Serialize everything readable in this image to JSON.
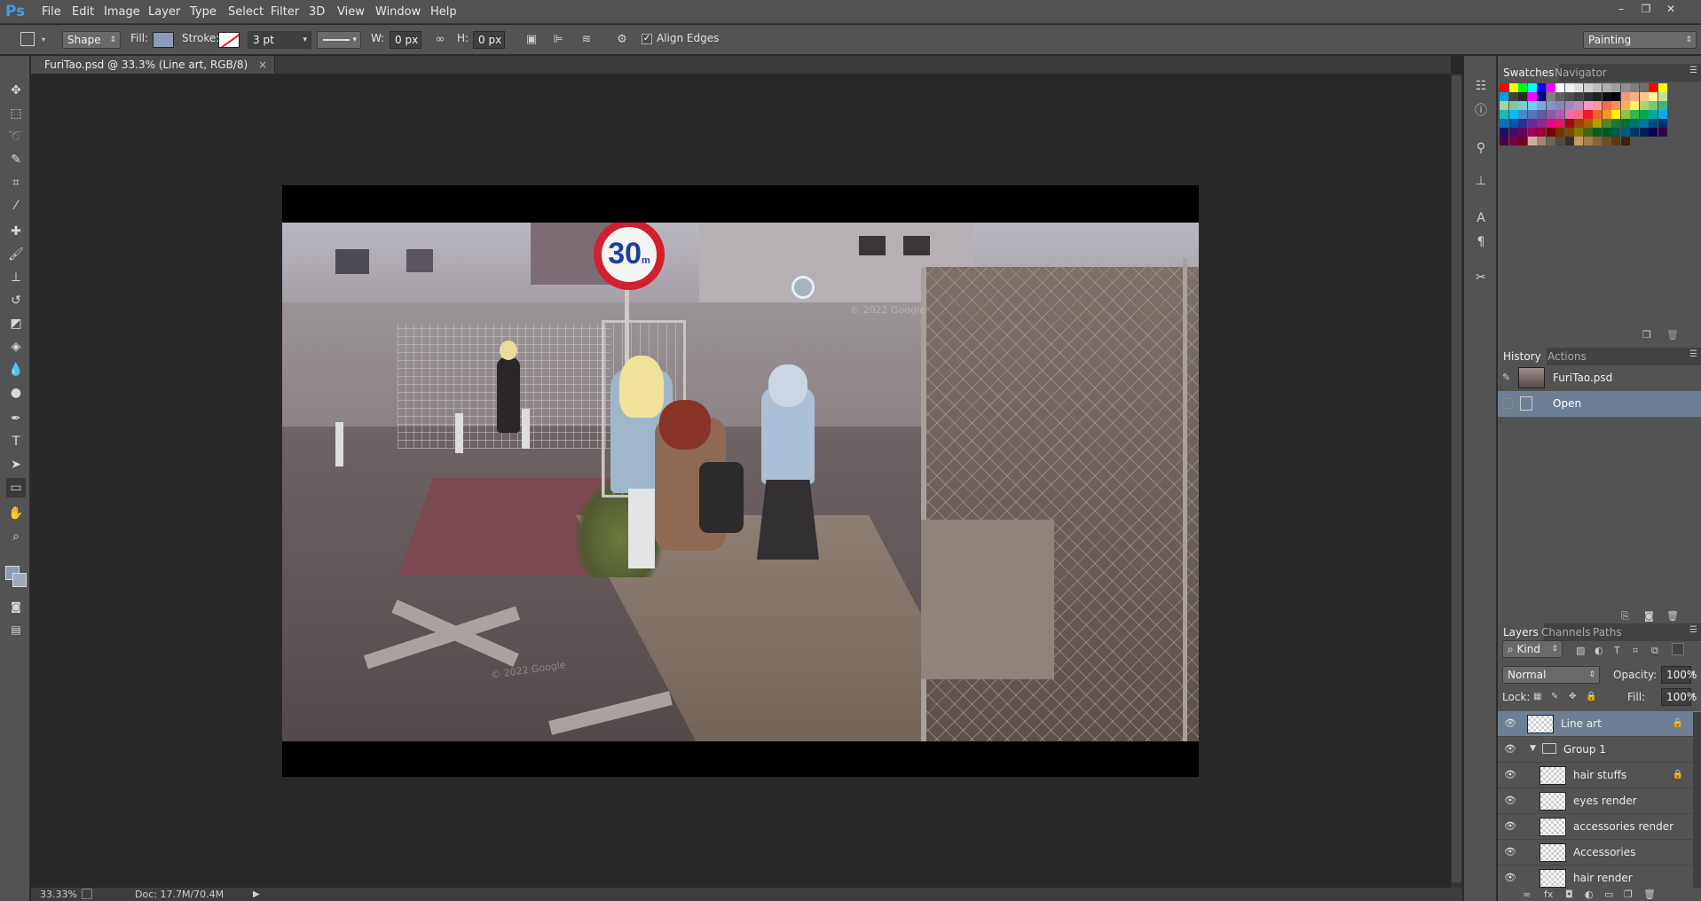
{
  "app": {
    "logo": "Ps"
  },
  "menu": [
    "File",
    "Edit",
    "Image",
    "Layer",
    "Type",
    "Select",
    "Filter",
    "3D",
    "View",
    "Window",
    "Help"
  ],
  "window_controls": {
    "minimize": "–",
    "restore": "❐",
    "close": "✕"
  },
  "options": {
    "tool_mode": "Shape",
    "fill_label": "Fill:",
    "fill_color": "#8b9bb8",
    "stroke_label": "Stroke:",
    "stroke_width": "3 pt",
    "w_label": "W:",
    "w_value": "0 px",
    "h_label": "H:",
    "h_value": "0 px",
    "align_edges_label": "Align Edges",
    "align_edges_checked": true,
    "workspace": "Painting"
  },
  "document": {
    "tab_title": "FuriTao.psd @ 33.3% (Line art, RGB/8)",
    "tab_close": "×",
    "sign_text": "30",
    "sign_unit": "m",
    "watermark_1": "© 2022 Google",
    "watermark_2": "© 2022 Google"
  },
  "status": {
    "zoom": "33.33%",
    "doc_size": "Doc: 17.7M/70.4M"
  },
  "swatches": {
    "tab_active": "Swatches",
    "tab_other": "Navigator",
    "rows": [
      [
        "#ff0000",
        "#ffff00",
        "#00ff00",
        "#00ffff",
        "#0000ff",
        "#ff00ff",
        "#ffffff",
        "#f0f0f0",
        "#e0e0e0",
        "#cfcfcf",
        "#bfbfbf",
        "#afafaf",
        "#9f9f9f",
        "#8f8f8f",
        "#7f7f7f",
        "#6f6f6f",
        "#ff0000",
        "#ffff00"
      ],
      [
        "#00a0e0",
        "#404040",
        "#2a2a2a",
        "#ff00ff",
        "#000080",
        "#808080",
        "#5f5f5f",
        "#4f4f4f",
        "#3f3f3f",
        "#2f2f2f",
        "#1f1f1f",
        "#0f0f0f",
        "#000000",
        "#f7977a",
        "#fbad82",
        "#fdc68c",
        "#fff799",
        "#c4df9b"
      ],
      [
        "#a3d39c",
        "#82ca9d",
        "#7bcdc8",
        "#6ecff6",
        "#7ea7d8",
        "#8493ca",
        "#8882be",
        "#a187be",
        "#bc8dbf",
        "#f49ac2",
        "#f6989d",
        "#f26c4f",
        "#f68e55",
        "#fbaf5c",
        "#fff467",
        "#acd372",
        "#7cc576",
        "#3bb878"
      ],
      [
        "#1abbb4",
        "#00bff3",
        "#438ccb",
        "#5574b9",
        "#605ca8",
        "#855fa8",
        "#a763a9",
        "#f06eaa",
        "#f26d7d",
        "#ed1c24",
        "#f26522",
        "#f7941d",
        "#fff200",
        "#8dc63f",
        "#39b54a",
        "#00a651",
        "#00a99d",
        "#00aeef"
      ],
      [
        "#0072bc",
        "#0054a5",
        "#2e3192",
        "#662d91",
        "#92278f",
        "#ec008c",
        "#ed145b",
        "#9e0b0f",
        "#a0410d",
        "#a36209",
        "#aba000",
        "#598527",
        "#197b30",
        "#007236",
        "#00746b",
        "#0076a3",
        "#004a80",
        "#003471"
      ],
      [
        "#1b1464",
        "#440e62",
        "#630460",
        "#9e005d",
        "#9e0039",
        "#790000",
        "#7b2e00",
        "#7d4900",
        "#827b00",
        "#406618",
        "#005e20",
        "#005826",
        "#005952",
        "#005b7f",
        "#003663",
        "#002157",
        "#0d004c",
        "#32004b"
      ],
      [
        "#4b0049",
        "#7b0046",
        "#7a0026",
        "#c7b299",
        "#998675",
        "#736357",
        "#534741",
        "#37302a",
        "#c69c6d",
        "#a67c52",
        "#8c6239",
        "#754c24",
        "#603913",
        "#42210b"
      ]
    ]
  },
  "history": {
    "tab_active": "History",
    "tab_other": "Actions",
    "snapshot": "FuriTao.psd",
    "items": [
      "Open"
    ]
  },
  "layers_panel": {
    "tabs": [
      "Layers",
      "Channels",
      "Paths"
    ],
    "kind_label": "Kind",
    "blend_mode": "Normal",
    "opacity_label": "Opacity:",
    "opacity": "100%",
    "lock_label": "Lock:",
    "fill_label": "Fill:",
    "fill": "100%",
    "layers": [
      {
        "name": "Line art",
        "selected": true,
        "locked": true,
        "folder": false,
        "indent": 0
      },
      {
        "name": "Group 1",
        "selected": false,
        "locked": false,
        "folder": true,
        "indent": 0
      },
      {
        "name": "hair stuffs",
        "selected": false,
        "locked": true,
        "folder": false,
        "indent": 1
      },
      {
        "name": "eyes render",
        "selected": false,
        "locked": false,
        "folder": false,
        "indent": 1
      },
      {
        "name": "accessories render",
        "selected": false,
        "locked": false,
        "folder": false,
        "indent": 1
      },
      {
        "name": "Accessories",
        "selected": false,
        "locked": false,
        "folder": false,
        "indent": 1
      },
      {
        "name": "hair render",
        "selected": false,
        "locked": false,
        "folder": false,
        "indent": 1
      }
    ]
  },
  "icons": {
    "eye": "eye-icon",
    "lock": "lock-icon",
    "folder": "folder-icon"
  }
}
